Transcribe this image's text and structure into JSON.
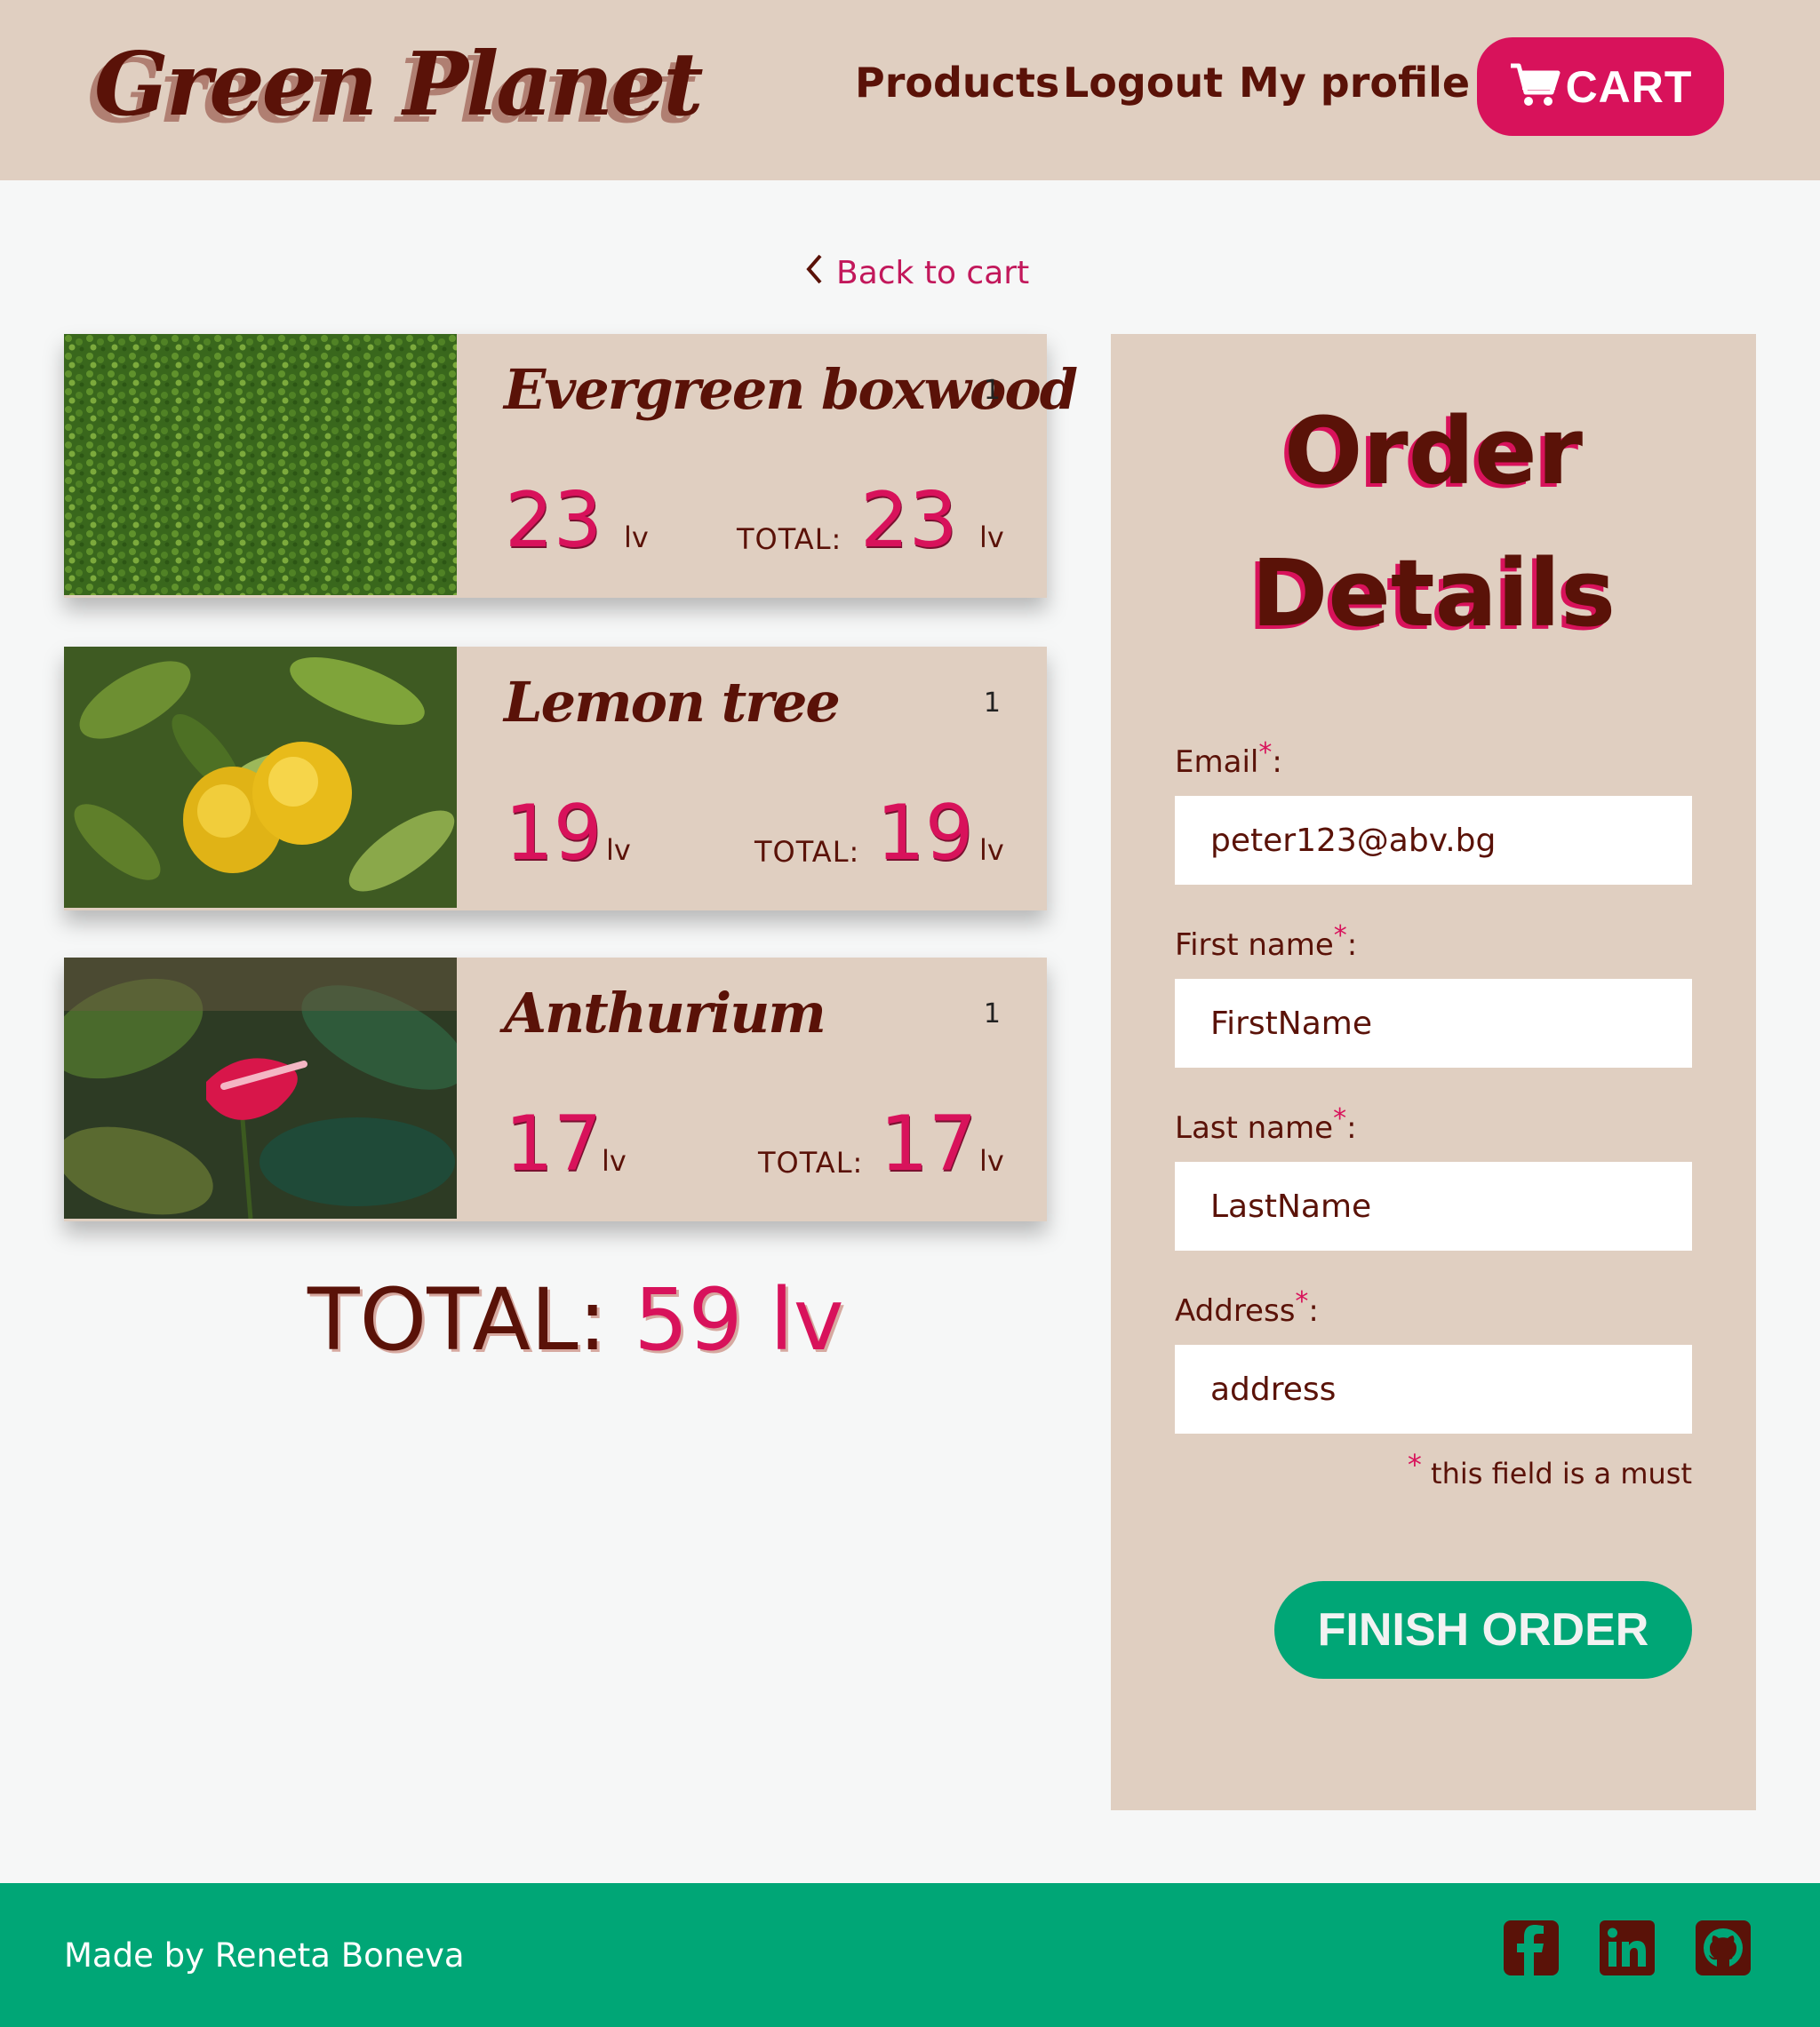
{
  "header": {
    "logo": "Green Planet",
    "nav": {
      "products": "Products",
      "logout": "Logout",
      "profile": "My profile"
    },
    "cart_label": "CART",
    "cart_icon": "shopping-cart-icon"
  },
  "back_link": {
    "label": "Back to cart",
    "icon": "chevron-left-icon"
  },
  "products": [
    {
      "name": "Evergreen boxwood",
      "qty": "1",
      "price": "23",
      "unit": "lv",
      "total_label": "TOTAL:",
      "total": "23",
      "image": "boxwood-hedge"
    },
    {
      "name": "Lemon tree",
      "qty": "1",
      "price": "19",
      "unit": "lv",
      "total_label": "TOTAL:",
      "total": "19",
      "image": "lemons-on-branch"
    },
    {
      "name": "Anthurium",
      "qty": "1",
      "price": "17",
      "unit": "lv",
      "total_label": "TOTAL:",
      "total": "17",
      "image": "red-anthurium-flower"
    }
  ],
  "grand_total": {
    "label": "TOTAL:",
    "value": "59 lv"
  },
  "order": {
    "title_line1": "Order",
    "title_line2": "Details",
    "required_mark": "*",
    "fields": {
      "email": {
        "label": "Email",
        "value": "peter123@abv.bg"
      },
      "first_name": {
        "label": "First name",
        "placeholder": "FirstName"
      },
      "last_name": {
        "label": "Last name",
        "placeholder": "LastName"
      },
      "address": {
        "label": "Address",
        "placeholder": "address"
      }
    },
    "must_note": "this field is a must",
    "finish_label": "FINISH ORDER"
  },
  "footer": {
    "made_by": "Made by Reneta Boneva",
    "icons": [
      "facebook-icon",
      "linkedin-icon",
      "github-icon"
    ]
  },
  "colors": {
    "brand_brown": "#5a1208",
    "accent_pink": "#d8125b",
    "beige": "#e0cfc1",
    "green": "#00a676"
  }
}
